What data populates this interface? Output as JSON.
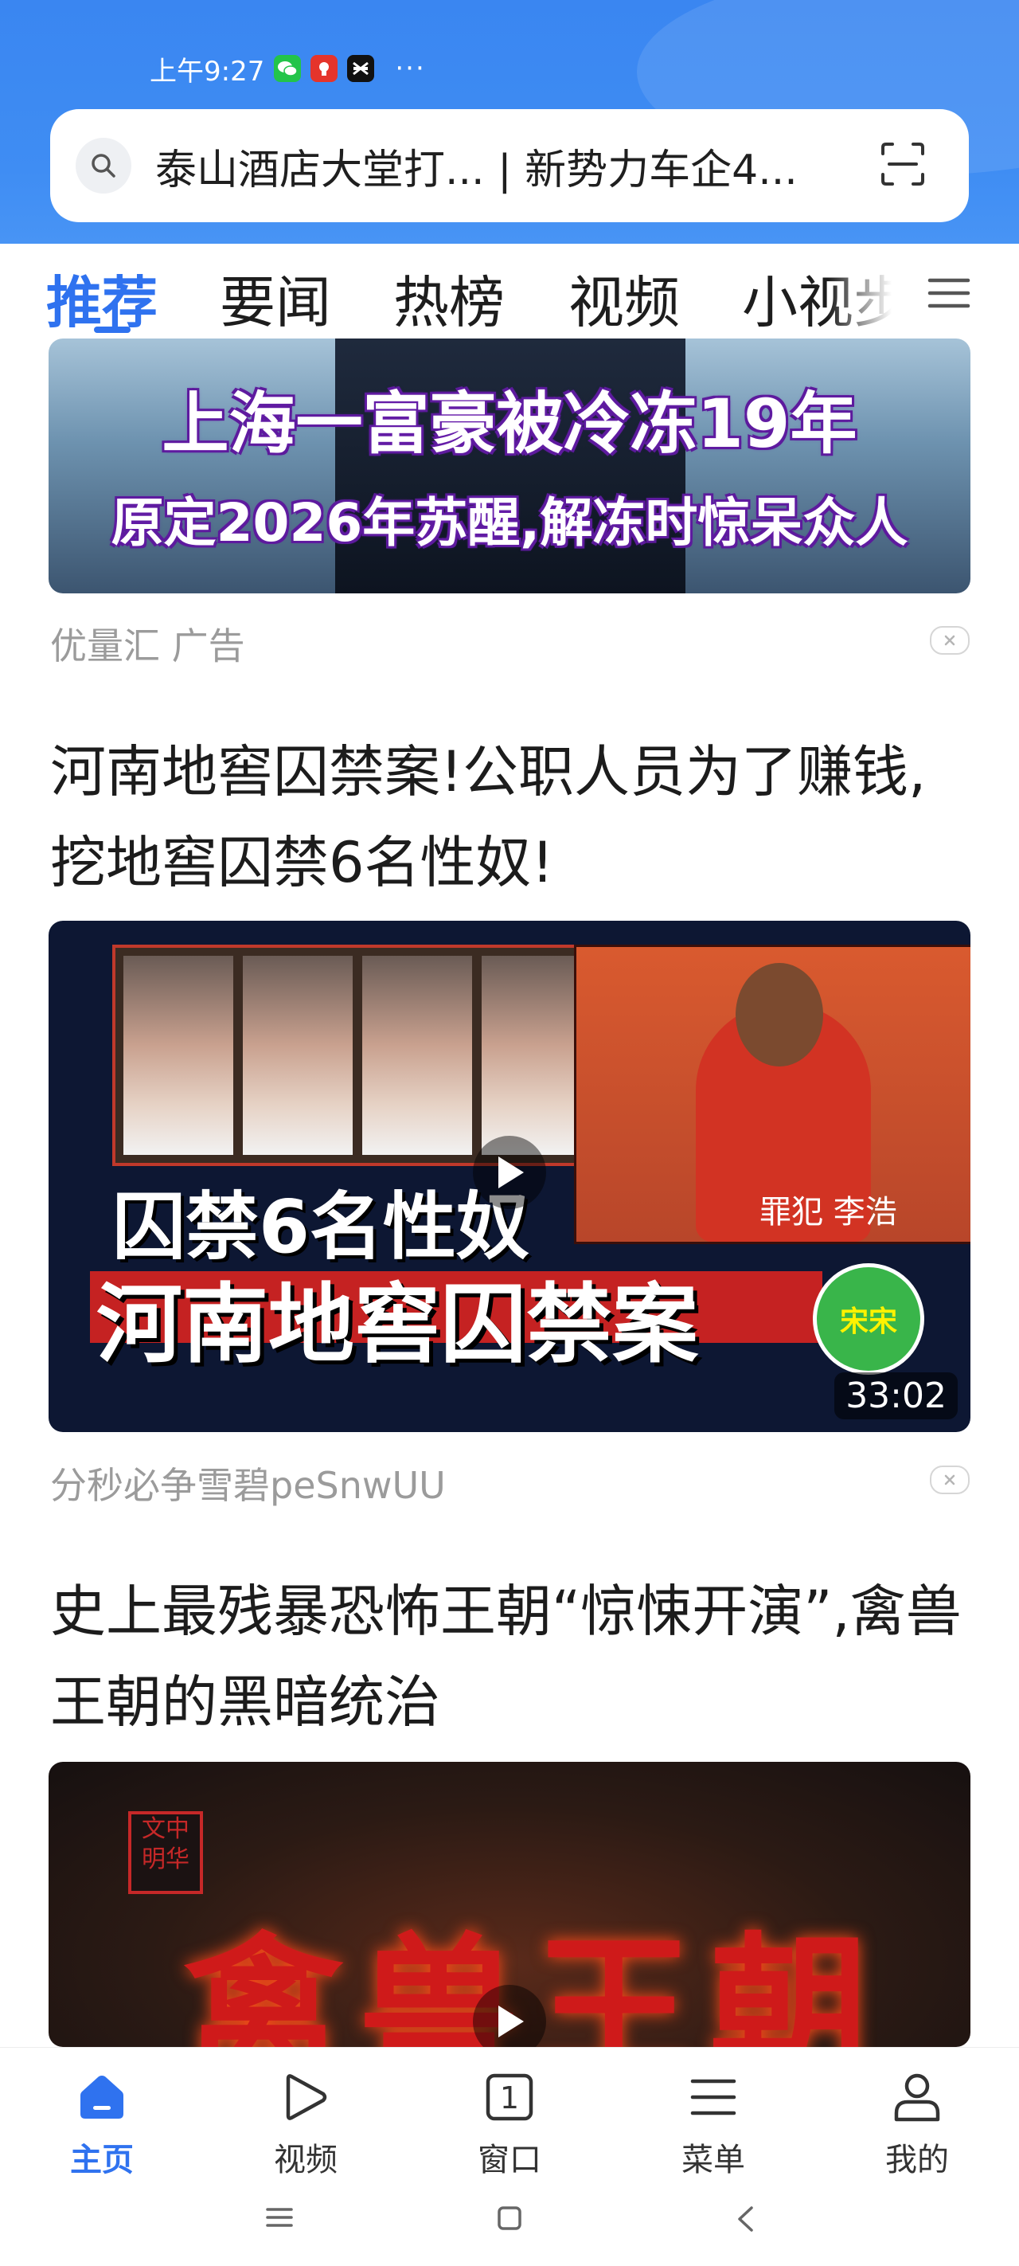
{
  "status_bar": {
    "time": "上午9:27",
    "more": "···"
  },
  "search": {
    "query": "泰山酒店大堂打... | 新势力车企4..."
  },
  "tabs": [
    "推荐",
    "要闻",
    "热榜",
    "视频",
    "小视步"
  ],
  "feed": {
    "ad": {
      "image_line1": "上海一富豪被冷冻19年",
      "image_line2": "原定2026年苏醒,解冻时惊呆众人",
      "source": "优量汇 广告"
    },
    "article1": {
      "headline": "河南地窖囚禁案!公职人员为了赚钱,挖地窖囚禁6名性奴!",
      "image_overlay_1": "囚禁6名性奴",
      "image_overlay_2": "河南地窖囚禁案",
      "image_label": "罪犯 李浩",
      "badge_text": "宋宋",
      "duration": "33:02",
      "source": "分秒必争雪碧peSnwUU"
    },
    "article2": {
      "headline": "史上最残暴恐怖王朝“惊悚开演”,禽兽王朝的黑暗统治",
      "image_seal": "文中明华",
      "image_title": "禽兽王朝"
    }
  },
  "bottom_nav": [
    {
      "label": "主页",
      "icon": "home-icon",
      "active": true
    },
    {
      "label": "视频",
      "icon": "play-icon",
      "active": false
    },
    {
      "label": "窗口",
      "icon": "window-count-icon",
      "active": false,
      "count": "1"
    },
    {
      "label": "菜单",
      "icon": "menu-icon",
      "active": false
    },
    {
      "label": "我的",
      "icon": "profile-icon",
      "active": false
    }
  ],
  "colors": {
    "accent": "#2f72ef",
    "header_blue": "#3f8df3",
    "meta_gray": "#9b9b9b"
  }
}
